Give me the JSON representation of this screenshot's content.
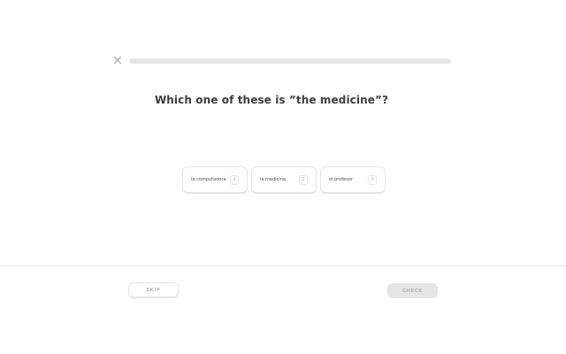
{
  "header": {
    "close_icon": "close-icon",
    "progress": 0
  },
  "question": {
    "text": "Which one of these is ”the medicine”?"
  },
  "choices": [
    {
      "text": "la computadora",
      "key": "1"
    },
    {
      "text": "la medicina",
      "key": "2"
    },
    {
      "text": "el profesor",
      "key": "3"
    }
  ],
  "footer": {
    "skip_label": "SKIP",
    "check_label": "CHECK"
  },
  "colors": {
    "track": "#e5e5e5",
    "text": "#3c3c3c",
    "muted": "#afafaf"
  }
}
